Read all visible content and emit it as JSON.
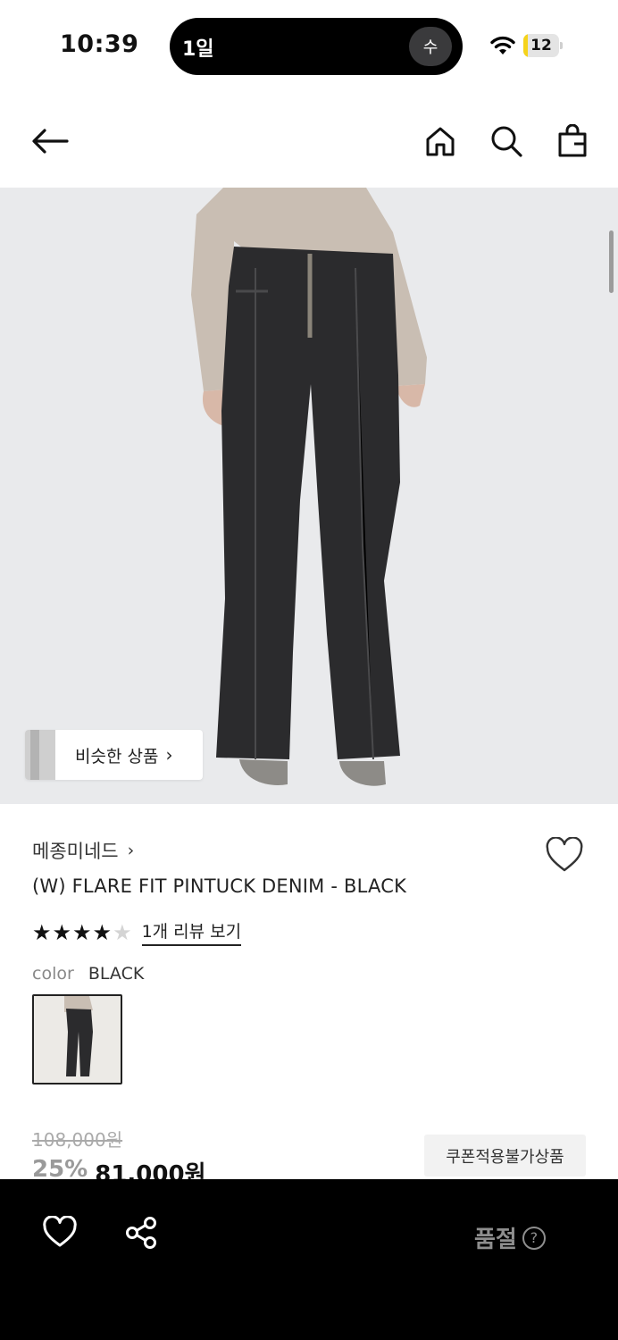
{
  "status_bar": {
    "time": "10:39",
    "island_text": "1일",
    "island_badge": "수",
    "battery_level": "12",
    "battery_fraction": 0.12,
    "battery_color": "#f5d31c"
  },
  "nav": {
    "back_icon": "arrow-left-icon",
    "home_icon": "home-icon",
    "search_icon": "search-icon",
    "bag_icon": "shopping-bag-icon"
  },
  "hero": {
    "background_color": "#e9eaec",
    "similar_label": "비슷한 상품",
    "similar_chevron": "›"
  },
  "product": {
    "brand": "메종미네드",
    "brand_chevron": "›",
    "title": "(W) FLARE FIT PINTUCK DENIM - BLACK",
    "rating": 4,
    "rating_max": 5,
    "reviews_link": "1개 리뷰 보기",
    "color_label": "color",
    "color_value": "BLACK",
    "original_price": "108,000원",
    "discount": "25%",
    "final_price": "81,000원",
    "coupon_badge": "쿠폰적용불가상품"
  },
  "bottom_bar": {
    "heart_icon": "heart-icon",
    "share_icon": "share-icon",
    "soldout_label": "품절",
    "help_icon": "?"
  }
}
